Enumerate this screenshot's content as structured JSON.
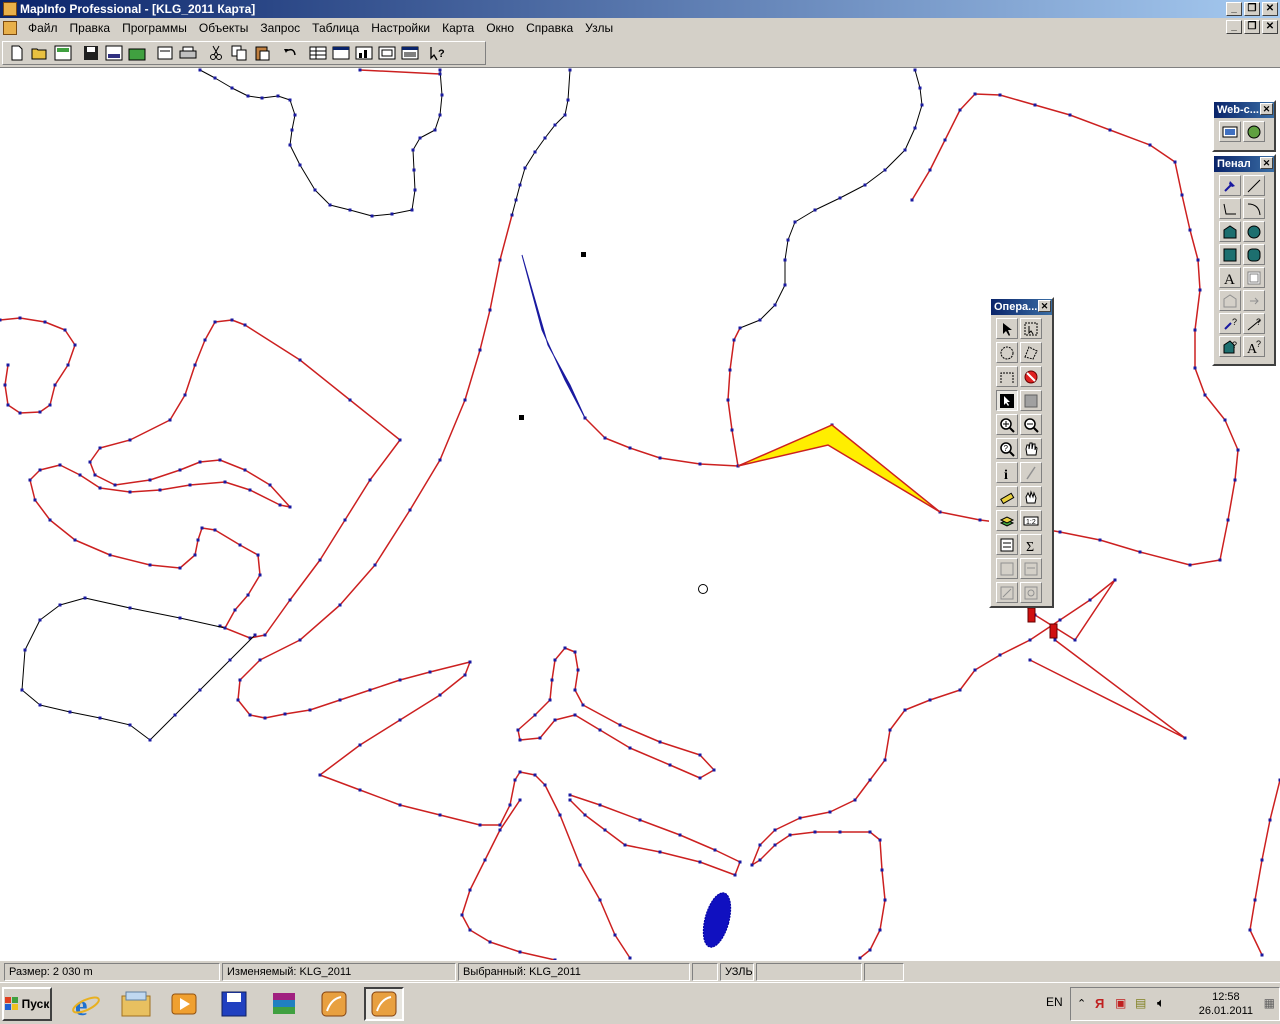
{
  "window": {
    "title": "MapInfo Professional - [KLG_2011 Карта]",
    "btn_minimize": "_",
    "btn_restore": "❐",
    "btn_close": "✕"
  },
  "menu": {
    "items": [
      "Файл",
      "Правка",
      "Программы",
      "Объекты",
      "Запрос",
      "Таблица",
      "Настройки",
      "Карта",
      "Окно",
      "Справка",
      "Узлы"
    ]
  },
  "toolbar": {
    "icons": [
      "new-icon",
      "open-icon",
      "open-workspace-icon",
      "save-icon",
      "save-workspace-icon",
      "open-dbms-icon",
      "print-setup-icon",
      "print-icon",
      "cut-icon",
      "copy-icon",
      "paste-icon",
      "undo-icon",
      "new-browser-icon",
      "new-map-icon",
      "new-graph-icon",
      "new-layout-icon",
      "new-redistrict-icon",
      "help-icon"
    ]
  },
  "palettes": {
    "web": {
      "title": "Web-с..."
    },
    "drawing": {
      "title": "Пенал"
    },
    "operations": {
      "title": "Опера..."
    }
  },
  "statusbar": {
    "size": "Размер: 2 030 m",
    "editable": "Изменяемый: KLG_2011",
    "selected": "Выбранный: KLG_2011",
    "mode": "УЗЛЫ"
  },
  "taskbar": {
    "start_label": "Пуск",
    "language": "EN",
    "time": "12:58",
    "date": "26.01.2011"
  },
  "colors": {
    "titlebar": "#0a246a",
    "boundary_red": "#cc2020",
    "vertex_blue": "#1a1aa0",
    "selection_yellow": "#ffee00",
    "water_blue": "#1010c0"
  }
}
